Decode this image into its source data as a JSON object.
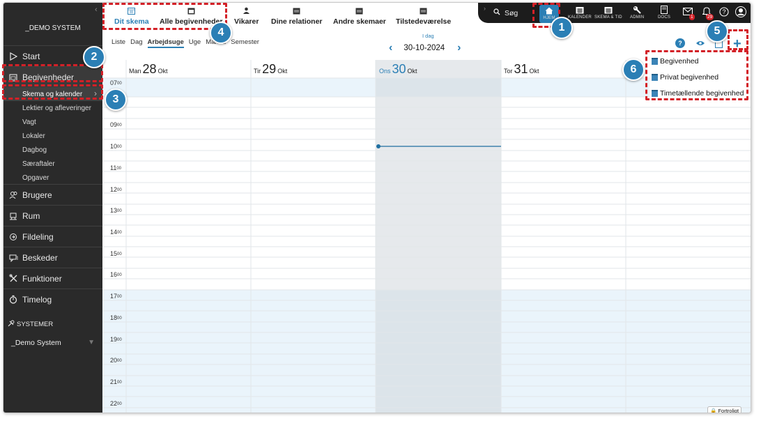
{
  "sidebar": {
    "system_name": "_DEMO SYSTEM",
    "items": [
      {
        "label": "Start",
        "icon": "play-triangle-icon"
      },
      {
        "label": "Begivenheder",
        "icon": "calendar-icon"
      },
      {
        "label": "Brugere",
        "icon": "users-icon"
      },
      {
        "label": "Rum",
        "icon": "room-icon"
      },
      {
        "label": "Fildeling",
        "icon": "file-share-icon"
      },
      {
        "label": "Beskeder",
        "icon": "messages-icon"
      },
      {
        "label": "Funktioner",
        "icon": "tools-icon"
      },
      {
        "label": "Timelog",
        "icon": "stopwatch-icon"
      }
    ],
    "sub_items": [
      "Skema og kalender",
      "Lektier og afleveringer",
      "Vagt",
      "Lokaler",
      "Dagbog",
      "Særaftaler",
      "Opgaver"
    ],
    "systems_heading": "SYSTEMER",
    "system_selector": "_Demo System"
  },
  "tabs": [
    "Dit skema",
    "Alle begivenheder",
    "Vikarer",
    "Dine relationer",
    "Andre skemaer",
    "Tilstedeværelse"
  ],
  "topbar": {
    "search": "Søg",
    "home": "HJEM",
    "calendar": "KALENDER",
    "schedule": "SKEMA & TID",
    "admin": "ADMIN",
    "docs": "DOCS",
    "mail_badge": "1",
    "notif_badge": "29"
  },
  "views": [
    "Liste",
    "Dag",
    "Arbejdsuge",
    "Uge",
    "Måned",
    "Semester"
  ],
  "active_view": "Arbejdsuge",
  "today_label": "I dag",
  "current_date": "30-10-2024",
  "days": [
    {
      "name": "Man",
      "num": "28",
      "month": "Okt"
    },
    {
      "name": "Tir",
      "num": "29",
      "month": "Okt"
    },
    {
      "name": "Ons",
      "num": "30",
      "month": "Okt"
    },
    {
      "name": "Tor",
      "num": "31",
      "month": "Okt"
    }
  ],
  "times": [
    "07",
    "09",
    "10",
    "11",
    "12",
    "13",
    "14",
    "15",
    "16",
    "17",
    "18",
    "19",
    "20",
    "21",
    "22"
  ],
  "time_suffix": "00",
  "first_row_time": "07",
  "dropdown": [
    "Begivenhed",
    "Privat begivenhed",
    "Timetællende begivenhed"
  ],
  "confidential": "Fortroligt",
  "steps": [
    "1",
    "2",
    "3",
    "4",
    "5",
    "6"
  ],
  "colors": {
    "accent": "#2b7fb5",
    "annotation": "#d32027",
    "sidebar": "#2a2a2a",
    "off_hours": "#eaf4fb"
  }
}
